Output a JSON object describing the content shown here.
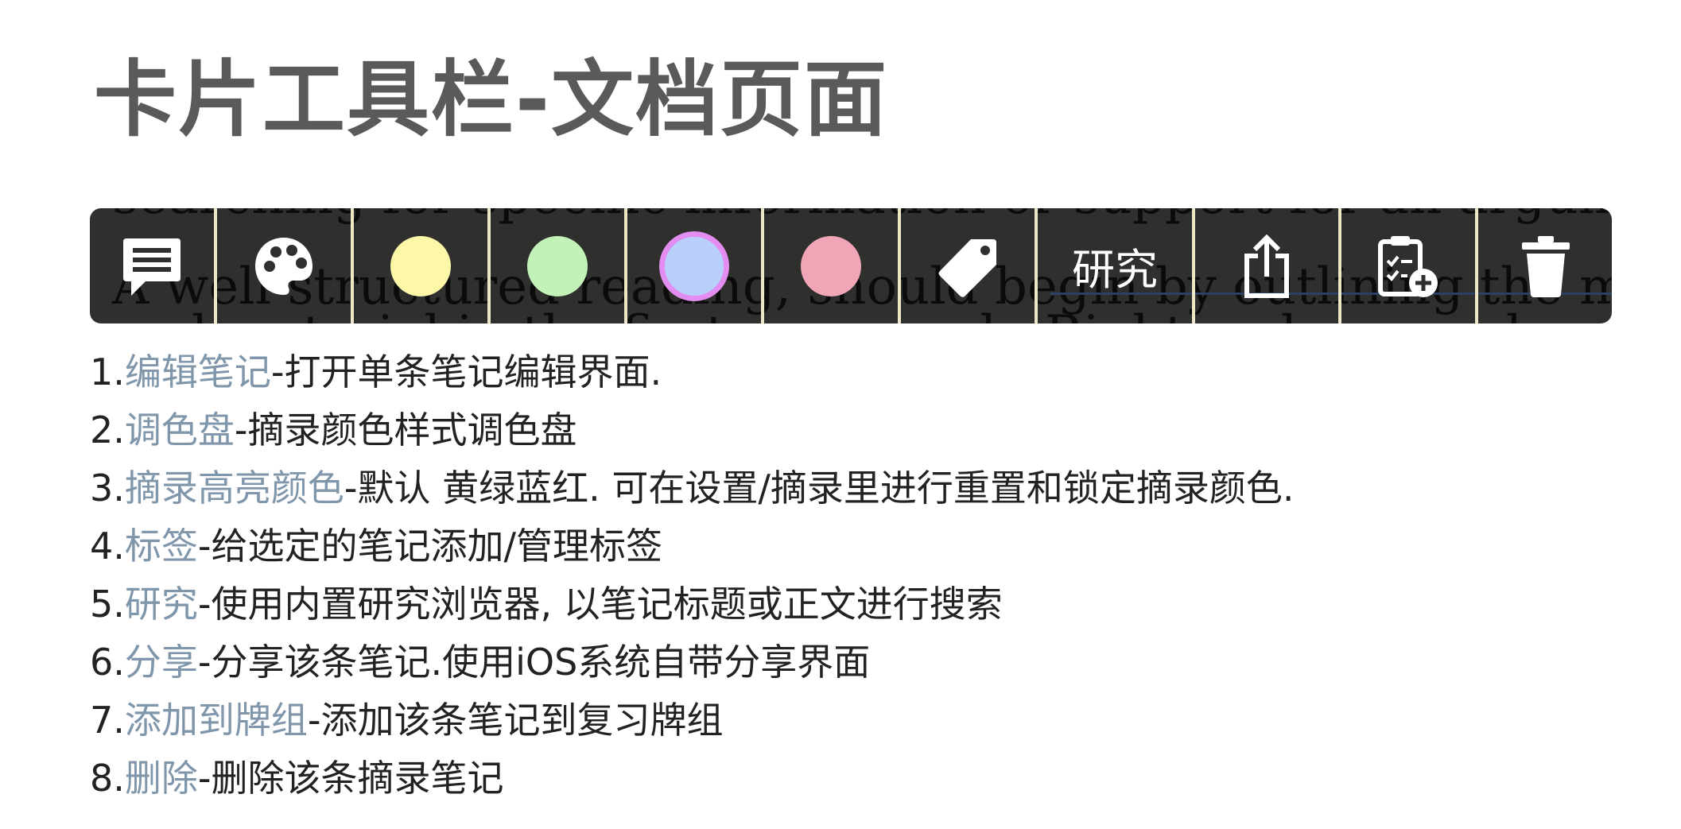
{
  "page": {
    "title": "卡片工具栏-文档页面"
  },
  "toolbar": {
    "background_text": {
      "line1": "searching for specific information or support for an argument.",
      "line2": "A well structured reading, should begin by outlining the main premise",
      "line3": "and material in the first paragraph. Right and proceeds"
    },
    "colors": {
      "background": "#2f2f2d",
      "divider": "#ede6c7",
      "selected_ring": "#e38df0"
    },
    "buttons": [
      {
        "name": "edit-note-button",
        "icon": "note-comment-icon"
      },
      {
        "name": "palette-button",
        "icon": "palette-icon"
      },
      {
        "name": "highlight-yellow-button",
        "swatch": "#fdf7a8",
        "selected": false
      },
      {
        "name": "highlight-green-button",
        "swatch": "#c3f2b8",
        "selected": false
      },
      {
        "name": "highlight-blue-button",
        "swatch": "#b8cffa",
        "selected": true
      },
      {
        "name": "highlight-red-button",
        "swatch": "#f0a6b7",
        "selected": false
      },
      {
        "name": "tag-button",
        "icon": "tag-icon"
      },
      {
        "name": "research-button",
        "label": "研究"
      },
      {
        "name": "share-button",
        "icon": "share-icon"
      },
      {
        "name": "add-to-deck-button",
        "icon": "clipboard-add-icon"
      },
      {
        "name": "delete-button",
        "icon": "trash-icon"
      }
    ]
  },
  "features": [
    {
      "num": "1.",
      "name": "编辑笔记",
      "desc": "-打开单条笔记编辑界面."
    },
    {
      "num": "2.",
      "name": "调色盘",
      "desc": "-摘录颜色样式调色盘"
    },
    {
      "num": "3.",
      "name": "摘录高亮颜色",
      "desc": "-默认 黄绿蓝红. 可在设置/摘录里进行重置和锁定摘录颜色."
    },
    {
      "num": "4.",
      "name": "标签",
      "desc": "-给选定的笔记添加/管理标签"
    },
    {
      "num": "5.",
      "name": "研究",
      "desc": "-使用内置研究浏览器, 以笔记标题或正文进行搜索"
    },
    {
      "num": "6.",
      "name": "分享",
      "desc": "-分享该条笔记.使用iOS系统自带分享界面"
    },
    {
      "num": "7.",
      "name": "添加到牌组",
      "desc": "-添加该条笔记到复习牌组"
    },
    {
      "num": "8.",
      "name": "删除",
      "desc": "-删除该条摘录笔记"
    }
  ],
  "styles": {
    "title_color": "#5a5a5a",
    "feature_name_color": "#7f96ab",
    "body_text_color": "#222222"
  }
}
